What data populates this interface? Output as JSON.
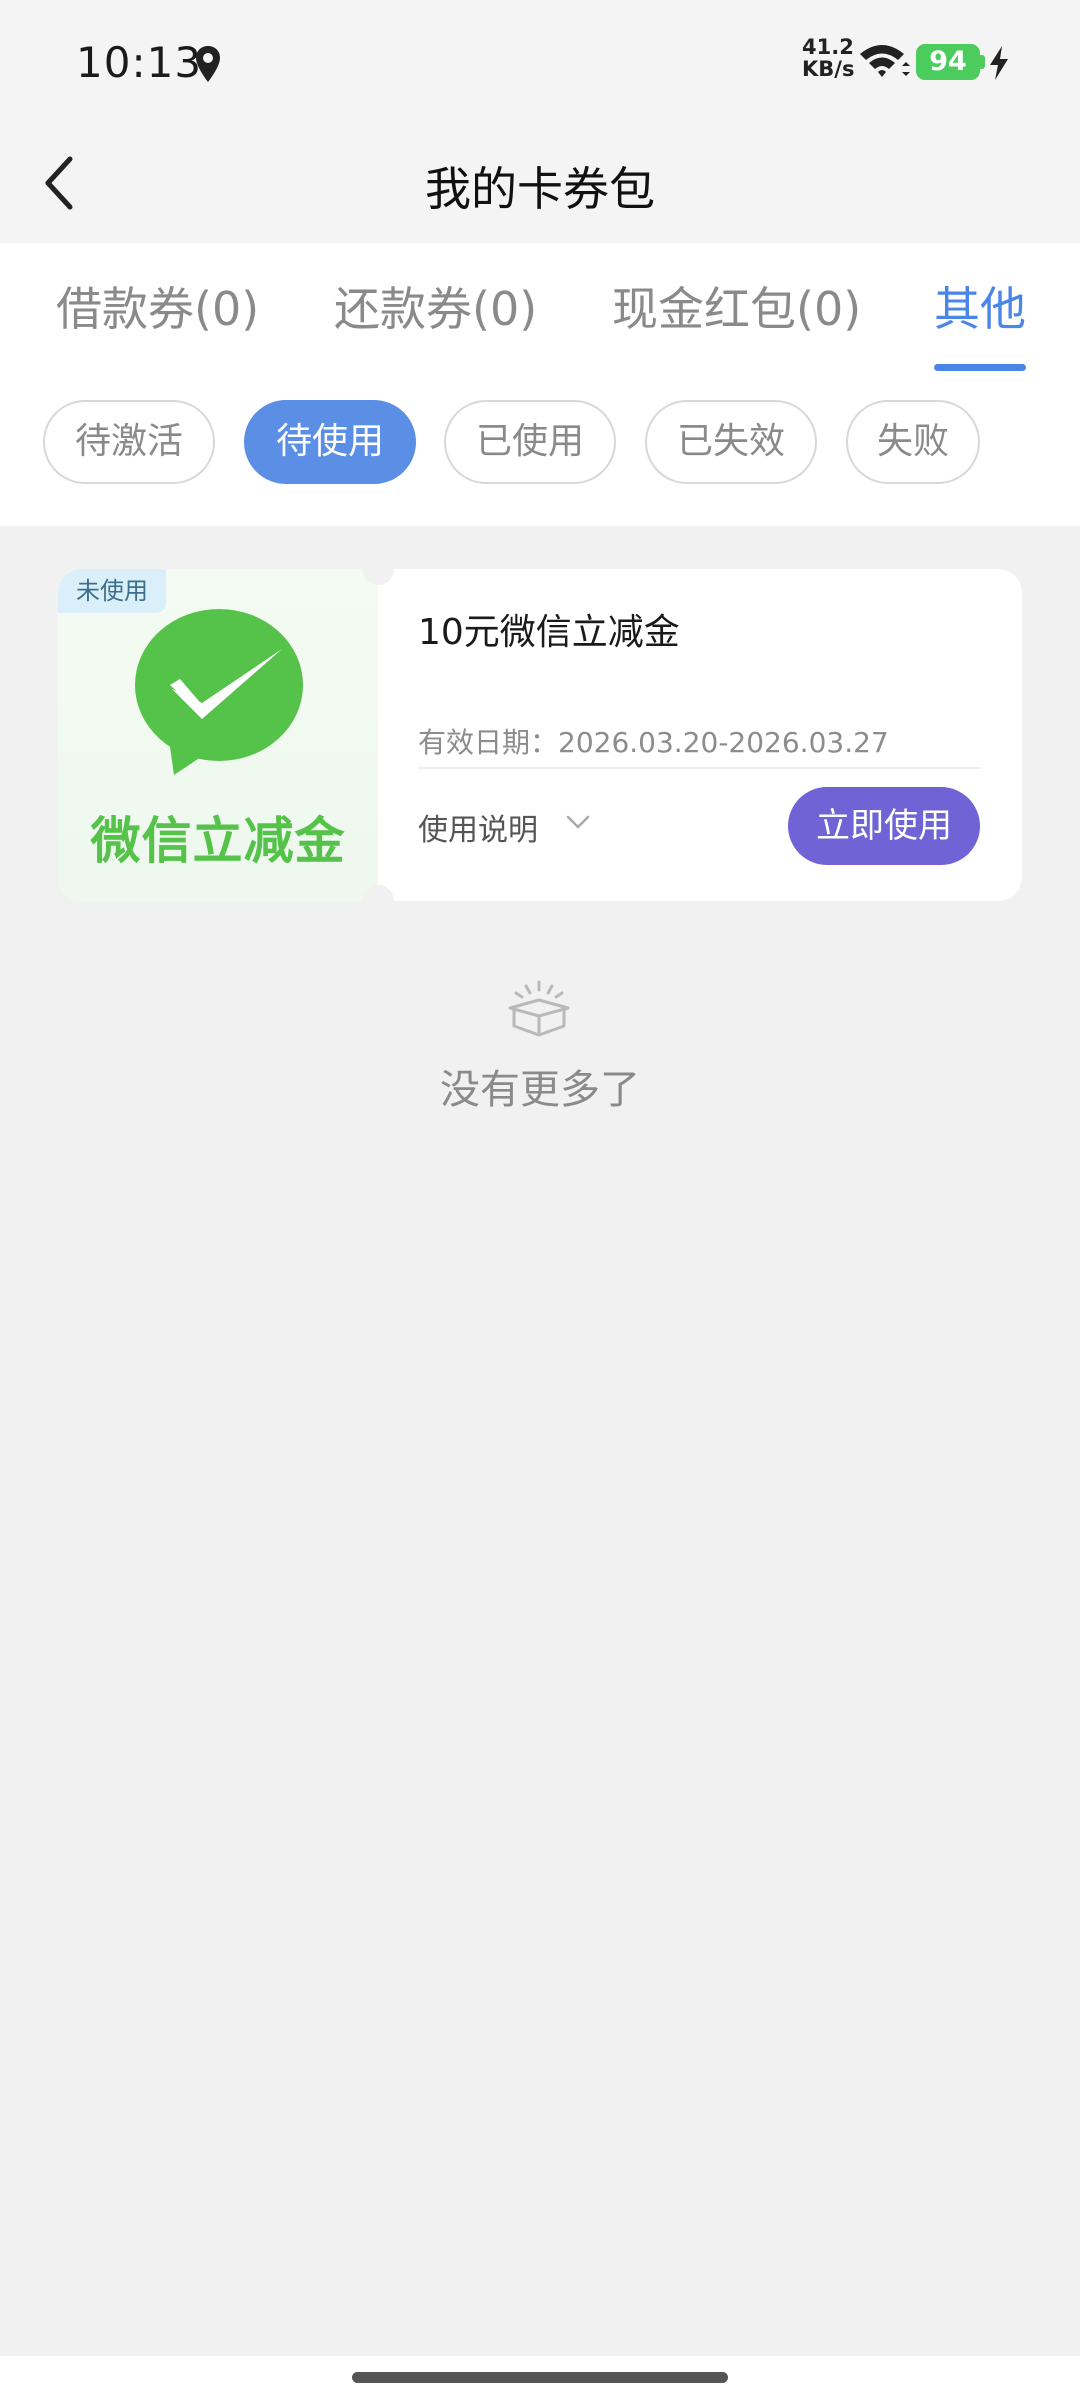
{
  "status_bar": {
    "time": "10:13",
    "net_speed_value": "41.2",
    "net_speed_unit": "KB/s",
    "battery": "94",
    "icons": [
      "location-icon",
      "wifi-icon",
      "charging-icon"
    ]
  },
  "header": {
    "title": "我的卡券包",
    "back_icon": "back-chevron-icon"
  },
  "tabs": [
    {
      "label": "借款券(0)",
      "active": false
    },
    {
      "label": "还款券(0)",
      "active": false
    },
    {
      "label": "现金红包(0)",
      "active": false
    },
    {
      "label": "其他",
      "active": true
    }
  ],
  "filters": [
    {
      "label": "待激活",
      "active": false
    },
    {
      "label": "待使用",
      "active": true
    },
    {
      "label": "已使用",
      "active": false
    },
    {
      "label": "已失效",
      "active": false
    },
    {
      "label": "失败",
      "active": false
    }
  ],
  "coupon": {
    "badge": "未使用",
    "logo_text": "微信立减金",
    "title": "10元微信立减金",
    "validity": "有效日期：2026.03.20-2026.03.27",
    "usage_label": "使用说明",
    "use_button": "立即使用"
  },
  "empty": {
    "text": "没有更多了",
    "icon": "empty-box-icon"
  },
  "colors": {
    "accent": "#4a86e8",
    "use_button": "#6f63d6",
    "wechat_green": "#55c24a",
    "battery": "#4ccc5d"
  }
}
